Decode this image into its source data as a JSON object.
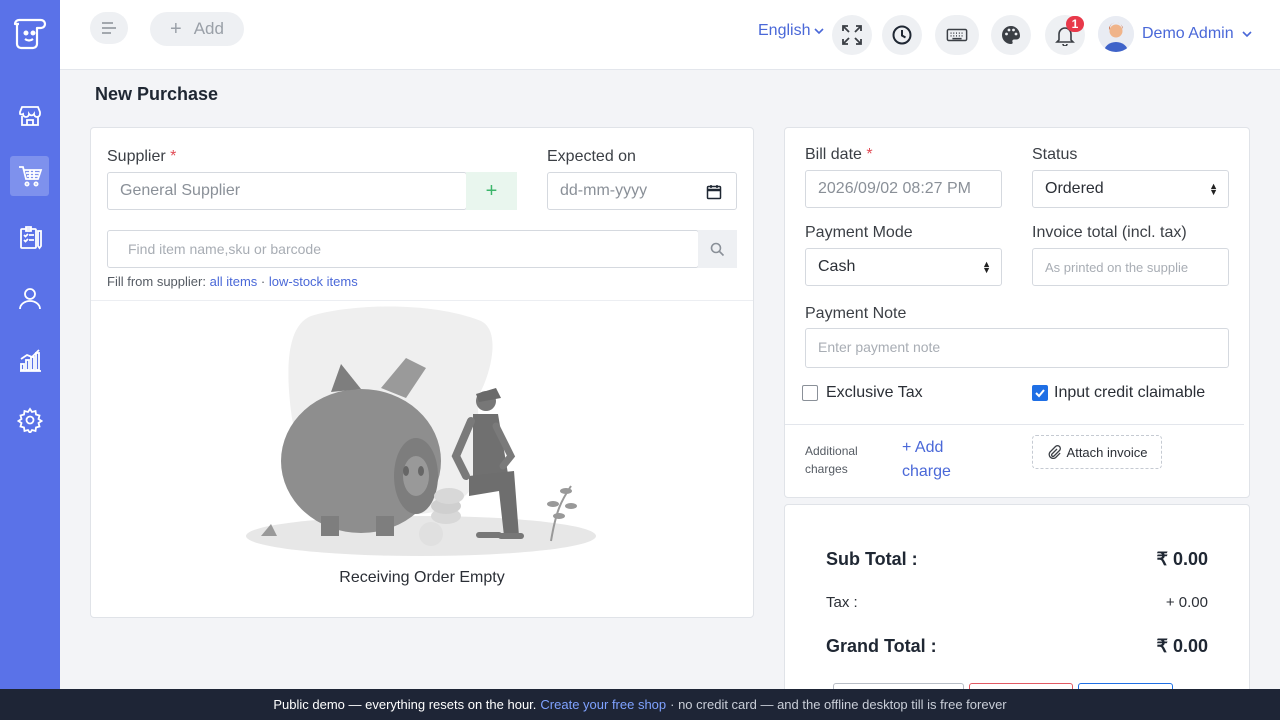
{
  "header": {
    "add_label": "Add",
    "language": "English",
    "notification_count": "1",
    "user_name": "Demo Admin"
  },
  "sidebar": {
    "items": [
      {
        "icon": "store-icon",
        "active": false
      },
      {
        "icon": "cart-icon",
        "active": true
      },
      {
        "icon": "clipboard-icon",
        "active": false
      },
      {
        "icon": "user-icon",
        "active": false
      },
      {
        "icon": "analytics-icon",
        "active": false
      },
      {
        "icon": "gear-icon",
        "active": false
      }
    ]
  },
  "page": {
    "title": "New Purchase"
  },
  "left": {
    "supplier_label": "Supplier",
    "required_mark": "*",
    "supplier_value": "General Supplier",
    "plus": "+",
    "expected_label": "Expected on",
    "expected_placeholder": "dd-mm-yyyy",
    "search_placeholder": "Find item name,sku or barcode",
    "fill_prefix": "Fill from supplier:",
    "fill_all": "all items",
    "fill_sep": "·",
    "fill_low": "low-stock items",
    "empty_text": "Receiving Order Empty"
  },
  "right": {
    "bill_date_label": "Bill date",
    "bill_date_value": "2026/09/02 08:27 PM",
    "status_label": "Status",
    "status_value": "Ordered",
    "payment_mode_label": "Payment Mode",
    "payment_mode_value": "Cash",
    "invoice_total_label": "Invoice total (incl. tax)",
    "invoice_total_placeholder": "As printed on the supplie",
    "payment_note_label": "Payment Note",
    "payment_note_placeholder": "Enter payment note",
    "exclusive_tax_label": "Exclusive Tax",
    "exclusive_tax_checked": false,
    "input_credit_label": "Input credit claimable",
    "input_credit_checked": true,
    "additional_charges_label": "Additional charges",
    "add_charge_label": "+ Add charge",
    "attach_invoice_label": "Attach invoice"
  },
  "totals": {
    "sub_total_label": "Sub Total :",
    "sub_total_value": "₹ 0.00",
    "tax_label": "Tax :",
    "tax_value": "+ 0.00",
    "grand_total_label": "Grand Total :",
    "grand_total_value": "₹ 0.00"
  },
  "banner": {
    "text1": "Public demo — everything resets on the hour.",
    "link": "Create your free shop",
    "text2": "· no credit card — and the offline desktop till is free forever"
  },
  "colors": {
    "sidebar": "#5a72e8",
    "accent": "#4a68d8",
    "banner": "#1e2536",
    "badge": "#e8394a",
    "success": "#3bb56a"
  }
}
